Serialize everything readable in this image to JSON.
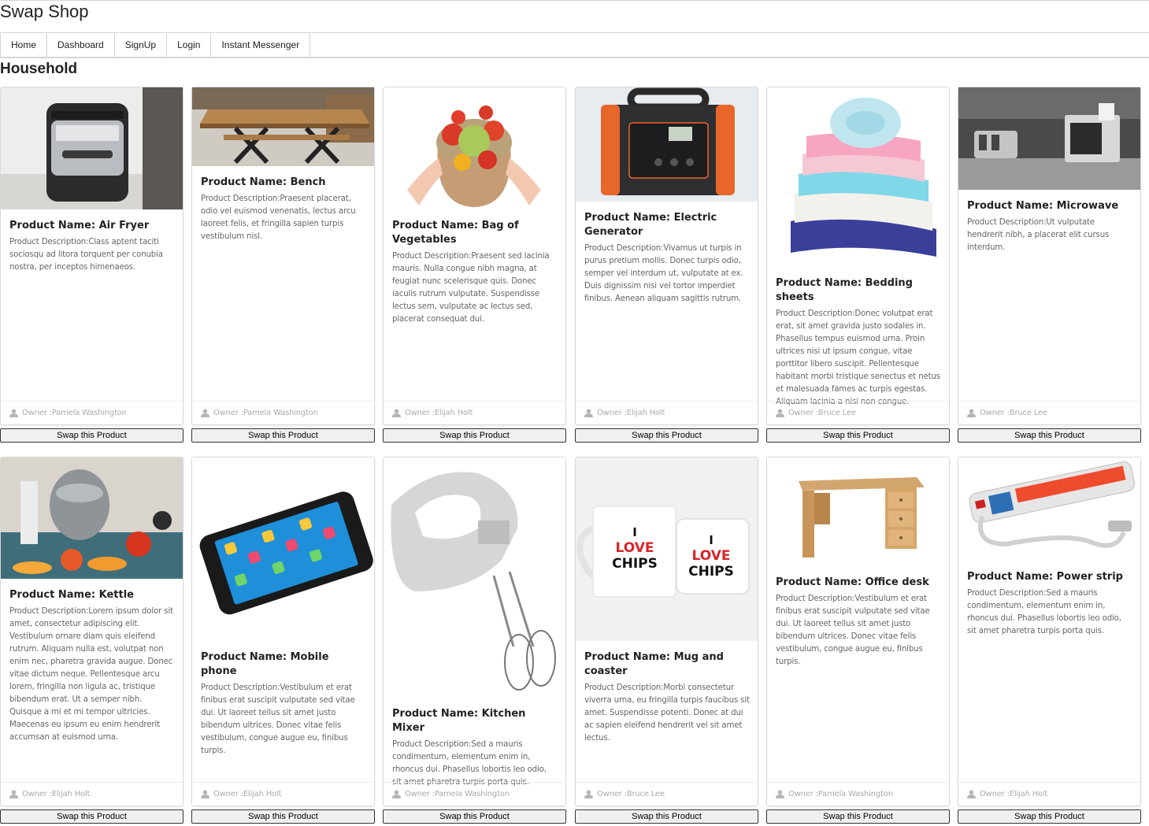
{
  "site": {
    "title": "Swap Shop"
  },
  "nav": {
    "items": [
      "Home",
      "Dashboard",
      "SignUp",
      "Login",
      "Instant Messenger"
    ]
  },
  "category": "Household",
  "labels": {
    "name_prefix": "Product Name: ",
    "desc_prefix": "Product Description:",
    "owner_prefix": "Owner :",
    "swap": "Swap this Product"
  },
  "products": [
    {
      "name": "Air Fryer",
      "description": "Class aptent taciti sociosqu ad litora torquent per conubia nostra, per inceptos himenaeos.",
      "owner": "Pamela Washington",
      "image": "air-fryer-photo"
    },
    {
      "name": "Bench",
      "description": "Praesent placerat, odio vel euismod venenatis, lectus arcu laoreet felis, et fringilla sapien turpis vestibulum nisl.",
      "owner": "Pamela Washington",
      "image": "bench-photo"
    },
    {
      "name": "Bag of Vegetables",
      "description": "Praesent sed lacinia mauris. Nulla congue nibh magna, at feugiat nunc scelerisque quis. Donec iaculis rutrum vulputate. Suspendisse lectus sem, vulputate ac lectus sed, placerat consequat dui.",
      "owner": "Elijah Holt",
      "image": "vegetables-photo"
    },
    {
      "name": "Electric Generator",
      "description": "Vivamus ut turpis in purus pretium mollis. Donec turpis odio, semper vel interdum ut, vulputate at ex. Duis dignissim nisi vel tortor imperdiet finibus. Aenean aliquam sagittis rutrum.",
      "owner": "Elijah Holt",
      "image": "generator-photo"
    },
    {
      "name": "Bedding sheets",
      "description": "Donec volutpat erat erat, sit amet gravida justo sodales in. Phasellus tempus euismod urna. Proin ultrices nisi ut ipsum congue, vitae porttitor libero suscipit. Pellentesque habitant morbi tristique senectus et netus et malesuada fames ac turpis egestas. Aliquam lacinia a nisi non congue.",
      "owner": "Bruce Lee",
      "image": "bedding-photo"
    },
    {
      "name": "Microwave",
      "description": "Ut vulputate hendrerit nibh, a placerat elit cursus interdum.",
      "owner": "Bruce Lee",
      "image": "microwave-photo"
    },
    {
      "name": "Kettle",
      "description": "Lorem ipsum dolor sit amet, consectetur adipiscing elit. Vestibulum ornare diam quis eleifend rutrum. Aliquam nulla est, volutpat non enim nec, pharetra gravida augue. Donec vitae dictum neque. Pellentesque arcu lorem, fringilla non ligula ac, tristique bibendum erat. Ut a semper nibh. Quisque a mi et mi tempor ultricies. Maecenas eu ipsum eu enim hendrerit accumsan at euismod urna.",
      "owner": "Elijah Holt",
      "image": "kettle-photo"
    },
    {
      "name": "Mobile phone",
      "description": "Vestibulum et erat finibus erat suscipit vulputate sed vitae dui. Ut laoreet tellus sit amet justo bibendum ultrices. Donec vitae felis vestibulum, congue augue eu, finibus turpis.",
      "owner": "Elijah Holt",
      "image": "phone-photo"
    },
    {
      "name": "Kitchen Mixer",
      "description": "Sed a mauris condimentum, elementum enim in, rhoncus dui. Phasellus lobortis leo odio, sit amet pharetra turpis porta quis.",
      "owner": "Pamela Washington",
      "image": "mixer-photo"
    },
    {
      "name": "Mug and coaster",
      "description": "Morbi consectetur viverra urna, eu fringilla turpis faucibus sit amet. Suspendisse potenti. Donec at dui ac sapien eleifend hendrerit vel sit amet lectus.",
      "owner": "Bruce Lee",
      "image": "mug-photo",
      "image_text": [
        "I",
        "LOVE",
        "CHIPS"
      ]
    },
    {
      "name": "Office desk",
      "description": "Vestibulum et erat finibus erat suscipit vulputate sed vitae dui. Ut laoreet tellus sit amet justo bibendum ultrices. Donec vitae felis vestibulum, congue augue eu, finibus turpis.",
      "owner": "Pamela Washington",
      "image": "desk-photo"
    },
    {
      "name": "Power strip",
      "description": "Sed a mauris condimentum, elementum enim in, rhoncus dui. Phasellus lobortis leo odio, sit amet pharetra turpis porta quis.",
      "owner": "Elijah Holt",
      "image": "power-strip-photo"
    }
  ]
}
